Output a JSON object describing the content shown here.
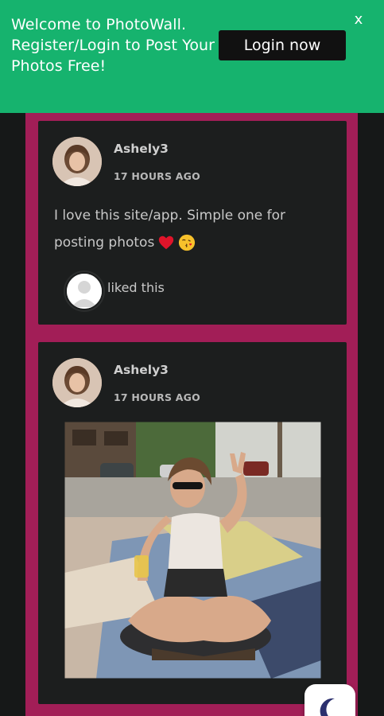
{
  "banner": {
    "message": "Welcome to PhotoWall. Register/Login to Post Your Photos Free!",
    "login_label": "Login now",
    "close_label": "x",
    "bg_color": "#16b36e"
  },
  "accent_color": "#a21e57",
  "posts": [
    {
      "username": "Ashely3",
      "time": "17 HOURS AGO",
      "text": "I love this site/app. Simple one for posting photos",
      "emojis": [
        "heart-icon",
        "kiss-face-icon"
      ],
      "liked_label": "liked this"
    },
    {
      "username": "Ashely3",
      "time": "17 HOURS AGO",
      "photo": "woman-sitting-on-street-photo"
    }
  ],
  "theme_toggle": {
    "icon": "moon-icon"
  }
}
